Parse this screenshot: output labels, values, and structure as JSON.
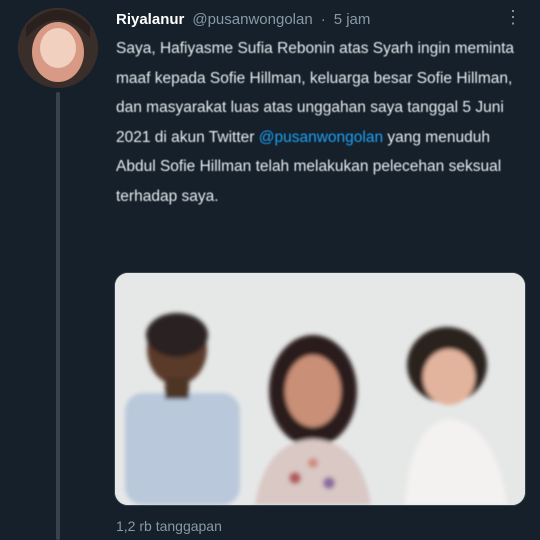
{
  "tweet": {
    "display_name": "Riyalanur",
    "handle": "@pusanwongolan",
    "separator": "·",
    "time": "5 jam",
    "more_icon": "more-options-icon",
    "body_before": "Saya, Hafiyasme Sufia Rebonin atas Syarh ingin meminta maaf kepada Sofie Hillman, keluarga besar Sofie Hillman, dan masyarakat luas atas unggahan saya tanggal 5 Juni 2021 di akun Twitter ",
    "mention": "@pusanwongolan",
    "body_after": " yang menuduh Abdul Sofie Hillman telah melakukan pelecehan seksual terhadap saya.",
    "stats": "1,2 rb tanggapan",
    "colors": {
      "background": "#15202b",
      "link": "#1da1f2",
      "muted": "#8899a6"
    }
  }
}
